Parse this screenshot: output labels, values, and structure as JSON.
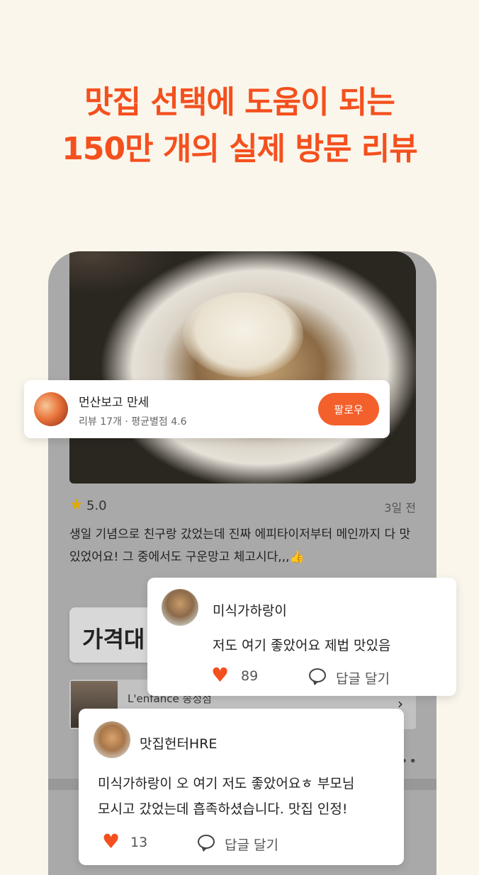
{
  "headline": {
    "line1": "맛집 선택에 도움이 되는",
    "line2": "150만 개의 실제 방문 리뷰"
  },
  "review": {
    "rating": "5.0",
    "time_ago": "3일 전",
    "text": "생일 기념으로 친구랑 갔었는데 진짜 에피타이저부터 메인까지 다 맛있었어요! 그 중에서도 구운망고 체고시다,,,👍"
  },
  "follow_card": {
    "name": "먼산보고 만세",
    "stats": "리뷰 17개 · 평균별점 4.6",
    "button_label": "팔로우"
  },
  "price_tag": {
    "label": "가격대"
  },
  "place": {
    "name": "L'enfance 송정점"
  },
  "comments": [
    {
      "name": "미식가하랑이",
      "text": "저도 여기 좋았어요 제법 맛있음",
      "likes": "89",
      "reply_label": "답글 달기"
    },
    {
      "name": "맛집헌터HRE",
      "line1": "미식가하랑이  오 여기 저도 좋았어요ㅎ 부모님",
      "line2": "모시고 갔었는데 흡족하셨습니다. 맛집 인정!",
      "likes": "13",
      "reply_label": "답글 달기"
    }
  ],
  "icons": {
    "star": "star-icon",
    "heart": "heart-icon",
    "speech": "speech-bubble-icon",
    "chevron": "chevron-right-icon",
    "more": "more-icon"
  },
  "colors": {
    "accent": "#f4501e",
    "follow_button": "#f4602c",
    "background": "#faf6ec",
    "star": "#e0a800"
  }
}
